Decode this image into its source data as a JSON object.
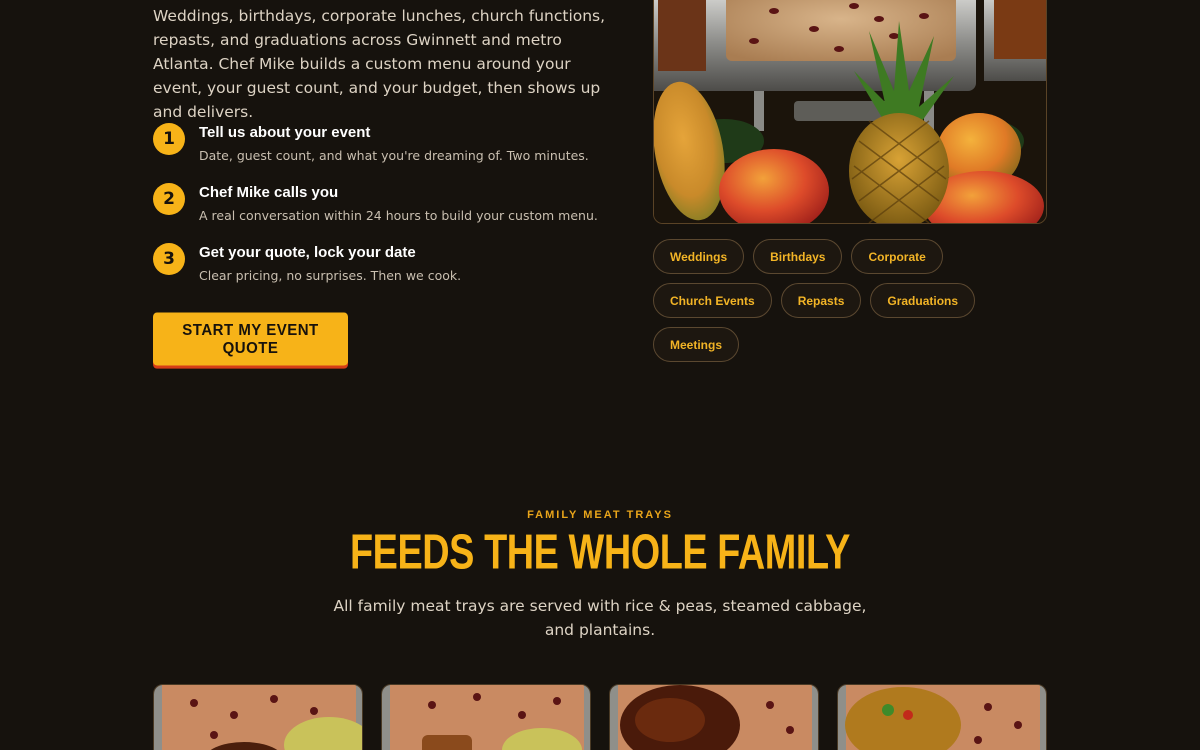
{
  "intro": {
    "text": "Weddings, birthdays, corporate lunches, church functions, repasts, and graduations across Gwinnett and metro Atlanta. Chef Mike builds a custom menu around your event, your guest count, and your budget, then shows up and delivers."
  },
  "steps": [
    {
      "num": "1",
      "title": "Tell us about your event",
      "desc": "Date, guest count, and what you're dreaming of. Two minutes."
    },
    {
      "num": "2",
      "title": "Chef Mike calls you",
      "desc": "A real conversation within 24 hours to build your custom menu."
    },
    {
      "num": "3",
      "title": "Get your quote, lock your date",
      "desc": "Clear pricing, no surprises. Then we cook."
    }
  ],
  "cta": {
    "label": "Start My Event Quote"
  },
  "event_tags": {
    "row1": [
      "Weddings",
      "Birthdays",
      "Corporate"
    ],
    "row2": [
      "Church Events",
      "Repasts",
      "Graduations"
    ],
    "row3": [
      "Meetings"
    ]
  },
  "trays": {
    "eyebrow": "FAMILY MEAT TRAYS",
    "title": "FEEDS THE WHOLE FAMILY",
    "subtitle": "All family meat trays are served with rice & peas, steamed cabbage, and plantains."
  },
  "colors": {
    "background": "#16120d",
    "accent": "#f7b318",
    "cta_shadow": "#d63d16",
    "tag_text": "#f2b426"
  }
}
